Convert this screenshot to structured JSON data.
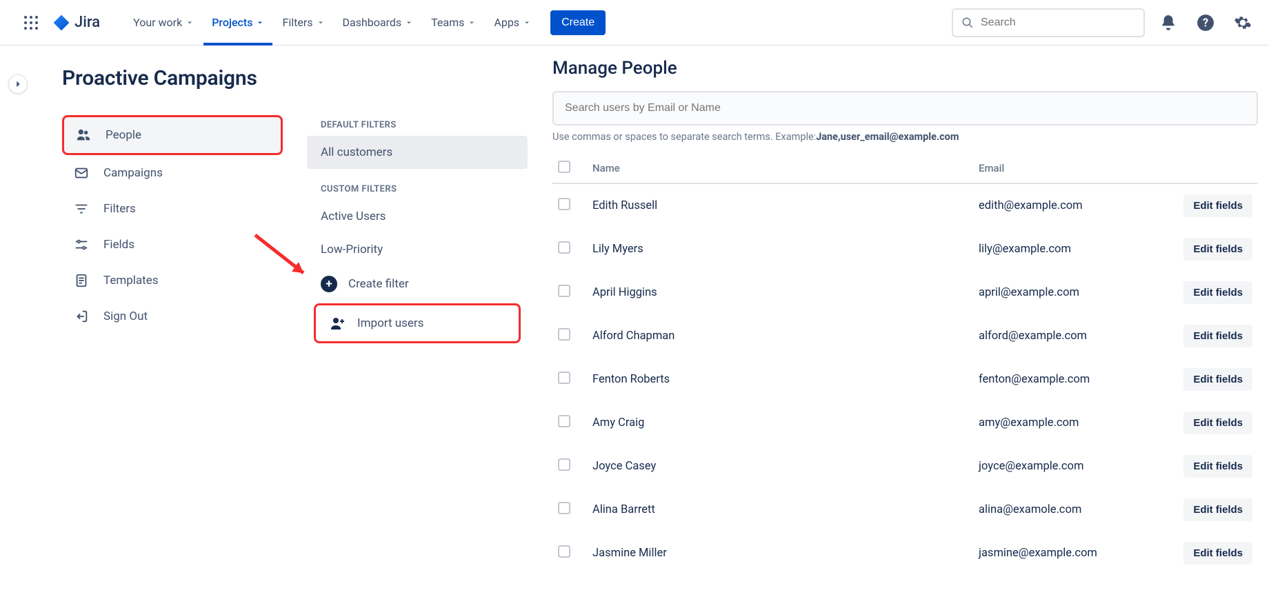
{
  "brand": {
    "name": "Jira"
  },
  "nav": {
    "items": [
      {
        "label": "Your work",
        "active": false
      },
      {
        "label": "Projects",
        "active": true
      },
      {
        "label": "Filters",
        "active": false
      },
      {
        "label": "Dashboards",
        "active": false
      },
      {
        "label": "Teams",
        "active": false
      },
      {
        "label": "Apps",
        "active": false
      }
    ],
    "create_label": "Create",
    "search_placeholder": "Search"
  },
  "project": {
    "title": "Proactive Campaigns"
  },
  "sidebar": {
    "items": [
      {
        "label": "People",
        "icon": "users-icon",
        "active": true
      },
      {
        "label": "Campaigns",
        "icon": "mail-icon"
      },
      {
        "label": "Filters",
        "icon": "filter-icon"
      },
      {
        "label": "Fields",
        "icon": "sliders-icon"
      },
      {
        "label": "Templates",
        "icon": "template-icon"
      },
      {
        "label": "Sign Out",
        "icon": "signout-icon"
      }
    ]
  },
  "filters": {
    "default_label": "DEFAULT FILTERS",
    "default_items": [
      {
        "label": "All customers",
        "active": true
      }
    ],
    "custom_label": "CUSTOM FILTERS",
    "custom_items": [
      {
        "label": "Active Users"
      },
      {
        "label": "Low-Priority"
      }
    ],
    "actions": [
      {
        "label": "Create filter",
        "icon": "plus-circle-icon"
      },
      {
        "label": "Import users",
        "icon": "userplus-icon",
        "highlight": true
      }
    ]
  },
  "main": {
    "heading": "Manage People",
    "search_placeholder": "Search users by Email or Name",
    "hint_prefix": "Use commas or spaces to separate search terms. Example:",
    "hint_example": "Jane,user_email@example.com",
    "columns": {
      "name": "Name",
      "email": "Email"
    },
    "action_label": "Edit fields",
    "rows": [
      {
        "name": "Edith Russell",
        "email": "edith@example.com"
      },
      {
        "name": "Lily Myers",
        "email": "lily@example.com"
      },
      {
        "name": "April Higgins",
        "email": "april@example.com"
      },
      {
        "name": "Alford Chapman",
        "email": "alford@example.com"
      },
      {
        "name": "Fenton Roberts",
        "email": "fenton@example.com"
      },
      {
        "name": "Amy Craig",
        "email": "amy@example.com"
      },
      {
        "name": "Joyce Casey",
        "email": "joyce@example.com"
      },
      {
        "name": "Alina Barrett",
        "email": "alina@examole.com"
      },
      {
        "name": "Jasmine Miller",
        "email": "jasmine@example.com"
      }
    ]
  }
}
